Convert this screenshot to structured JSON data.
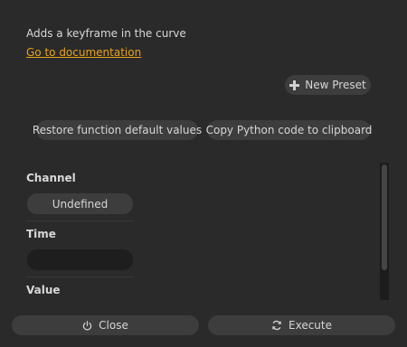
{
  "description": "Adds a keyframe in the curve",
  "doc_link": "Go to documentation",
  "presets": {
    "new_preset_label": "New Preset"
  },
  "actions": {
    "restore_label": "Restore function default values",
    "copy_python_label": "Copy Python code to clipboard"
  },
  "params": {
    "channel": {
      "label": "Channel",
      "value": "Undefined"
    },
    "time": {
      "label": "Time",
      "value": ""
    },
    "value": {
      "label": "Value"
    }
  },
  "footer": {
    "close_label": "Close",
    "execute_label": "Execute"
  },
  "icons": {
    "new_preset": "plus-icon",
    "close": "power-icon",
    "execute": "refresh-icon"
  },
  "colors": {
    "background": "#2a2a2a",
    "button": "#3d3d3d",
    "link": "#e8a317",
    "field": "#1e1e1e"
  }
}
